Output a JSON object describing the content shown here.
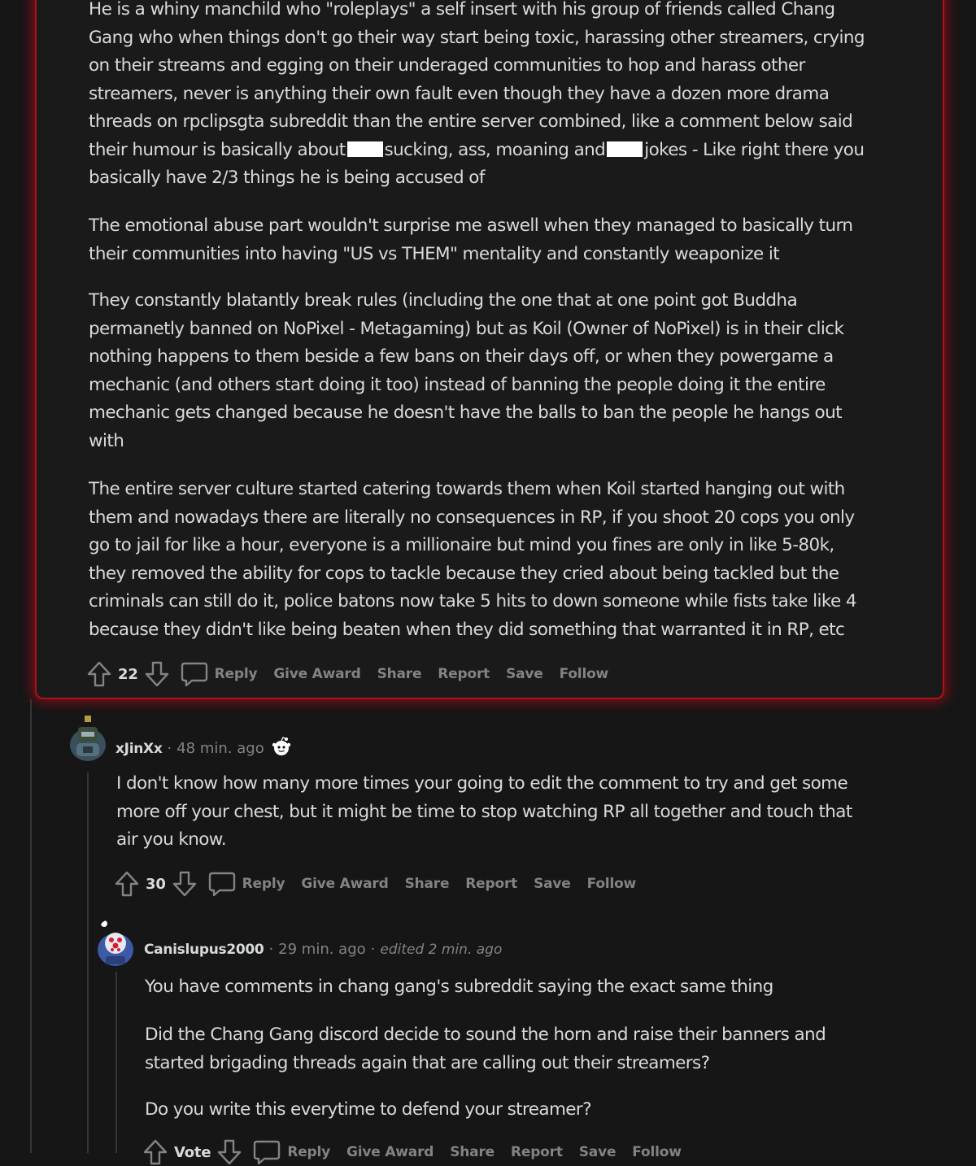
{
  "top_comment": {
    "paragraphs": [
      {
        "lines": [
          "He is a whiny manchild who \"roleplays\" a self insert with his group of friends called Chang",
          "Gang who when things don't go their way start being toxic, harassing other streamers, crying",
          "on their streams and egging on their underaged communities to hop and harass other",
          "streamers, never is anything their own fault even though they have a dozen more drama",
          "threads on rpclipsgta subreddit than the entire server combined, like a comment below said"
        ],
        "redacted_line": {
          "part1": "their humour is basically about",
          "part2": "sucking, ass, moaning and",
          "part3": "jokes - Like right there you"
        },
        "last_line": "basically have 2/3 things he is being accused of"
      },
      {
        "lines": [
          "The emotional abuse part wouldn't surprise me aswell when they managed to basically turn",
          "their communities into having \"US vs THEM\" mentality and constantly weaponize it"
        ]
      },
      {
        "lines": [
          "They constantly blatantly break rules (including the one that at one point got Buddha",
          "permanetly banned on NoPixel - Metagaming) but as Koil (Owner of NoPixel) is in their click",
          "nothing happens to them beside a few bans on their days off, or when they powergame a",
          "mechanic (and others start doing it too) instead of banning the people doing it the entire",
          "mechanic gets changed because he doesn't have the balls to ban the people he hangs out",
          "with"
        ]
      },
      {
        "lines": [
          "The entire server culture started catering towards them when Koil started hanging out with",
          "them and nowadays there are literally no consequences in RP, if you shoot 20 cops you only",
          "go to jail for like a hour, everyone is a millionaire but mind you fines are only in like 5-80k,",
          "they removed the ability for cops to tackle because they cried about being tackled but the",
          "criminals can still do it, police batons now take 5 hits to down someone while fists take like 4",
          "because they didn't like being beaten when they did something that warranted it in RP, etc"
        ]
      }
    ],
    "votes": "22",
    "actions": [
      "Reply",
      "Give Award",
      "Share",
      "Report",
      "Save",
      "Follow"
    ]
  },
  "reply1": {
    "username": "xJinXx",
    "time": "48 min. ago",
    "lines": [
      "I don't know how many more times your going to edit the comment to try and get some",
      "more off your chest, but it might be time to stop watching RP all together and touch that",
      "air you know."
    ],
    "votes": "30",
    "actions": [
      "Reply",
      "Give Award",
      "Share",
      "Report",
      "Save",
      "Follow"
    ]
  },
  "reply2": {
    "username": "Canislupus2000",
    "time": "29 min. ago",
    "edited": "edited 2 min. ago",
    "paragraphs": [
      [
        "You have comments in chang gang's subreddit saying the exact same thing"
      ],
      [
        "Did the Chang Gang discord decide to sound the horn and raise their banners and",
        "started brigading threads again that are calling out their streamers?"
      ],
      [
        "Do you write this everytime to defend your streamer?"
      ]
    ],
    "votes": "Vote",
    "actions": [
      "Reply",
      "Give Award",
      "Share",
      "Report",
      "Save",
      "Follow"
    ]
  },
  "icons": [
    "upvote-icon",
    "downvote-icon",
    "comment-icon",
    "snoo-icon"
  ],
  "colors": {
    "highlight": "#b0101a",
    "background": "#161617",
    "text": "#d7dadc",
    "muted": "#818384"
  }
}
